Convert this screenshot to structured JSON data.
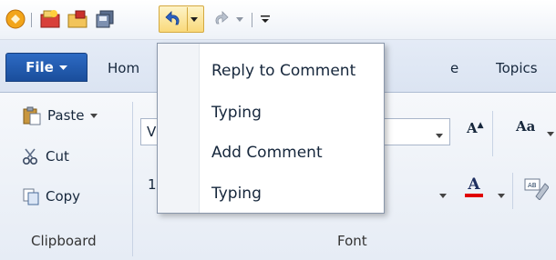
{
  "quick_access": {
    "undo_label": "Undo",
    "redo_label": "Redo",
    "customize_label": "Customize Quick Access Toolbar"
  },
  "file_tab": {
    "label": "File"
  },
  "tabs": [
    {
      "label": "Hom"
    },
    {
      "label": "e"
    },
    {
      "label": "Topics"
    }
  ],
  "clipboard": {
    "paste_label": "Paste",
    "cut_label": "Cut",
    "copy_label": "Copy",
    "group_label": "Clipboard"
  },
  "font": {
    "font_name_value": "V",
    "size_value": "1",
    "group_label": "Font",
    "grow_font_label": "A",
    "change_case_label": "Aa",
    "font_color_label": "A"
  },
  "undo_menu": {
    "items": [
      {
        "label": "Reply to Comment"
      },
      {
        "label": "Typing"
      },
      {
        "label": "Add Comment"
      },
      {
        "label": "Typing"
      }
    ]
  },
  "colors": {
    "file_tab_bg": "#1f5aab",
    "font_color_bar": "#e00000",
    "menu_border": "#8a97ab"
  }
}
